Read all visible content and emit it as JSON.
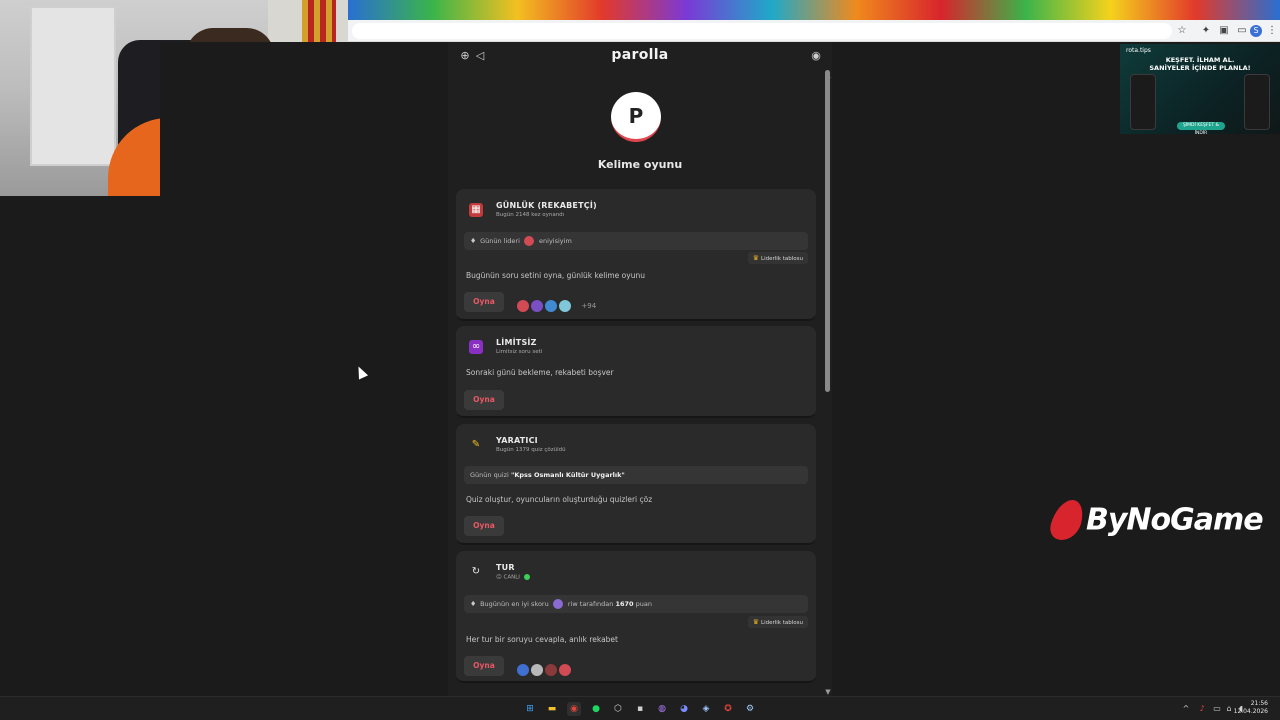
{
  "app": {
    "title": "parolla",
    "logo_letter": "P",
    "subtitle": "Kelime oyunu"
  },
  "cards": {
    "daily": {
      "title": "GÜNLÜK (REKABETÇİ)",
      "subtitle": "Bugün 2148 kez oynandı",
      "info_label": "Günün lideri",
      "info_user": "eniyisiyim",
      "leaderboard_label": "Liderlik tablosu",
      "description": "Bugünün soru setini oyna, günlük kelime oyunu",
      "play_label": "Oyna",
      "more_players": "+94"
    },
    "unlimited": {
      "title": "LİMİTSİZ",
      "subtitle": "Limitsiz soru seti",
      "description": "Sonraki günü bekleme, rekabeti boşver",
      "play_label": "Oyna"
    },
    "creative": {
      "title": "YARATICI",
      "subtitle": "Bugün 1379 quiz çözüldü",
      "info_label": "Günün quizi",
      "info_quiz": "\"Kpss Osmanlı Kültür Uygarlık\"",
      "description": "Quiz oluştur, oyuncuların oluşturduğu quizleri çöz",
      "play_label": "Oyna"
    },
    "tour": {
      "title": "TUR",
      "subtitle": "CANLI",
      "info_label": "Bugünün en iyi skoru",
      "info_user": "riw",
      "info_mid": "tarafından",
      "info_score": "1670",
      "info_unit": "puan",
      "leaderboard_label": "Liderlik tablosu",
      "description": "Her tur bir soruyu cevapla, anlık rekabet",
      "play_label": "Oyna"
    }
  },
  "ad": {
    "brand": "rota.tips",
    "headline_1": "KEŞFET. İLHAM AL.",
    "headline_2": "SANİYELER İÇİNDE PLANLA!",
    "cta": "ŞİMDİ KEŞFET & İNDİR"
  },
  "overlay": {
    "brand": "ByNoGame"
  },
  "taskbar": {
    "time": "21:56",
    "date": "12.04.2026"
  },
  "colors": {
    "accent": "#e85764",
    "card_bg": "#2a2a2a",
    "page_bg": "#1f1f1f",
    "live": "#3ccf5a",
    "trophy": "#e7b320"
  },
  "icons": {
    "daily": "calendar-icon",
    "unlimited": "infinity-icon",
    "creative": "pencil-icon",
    "tour": "refresh-icon"
  }
}
